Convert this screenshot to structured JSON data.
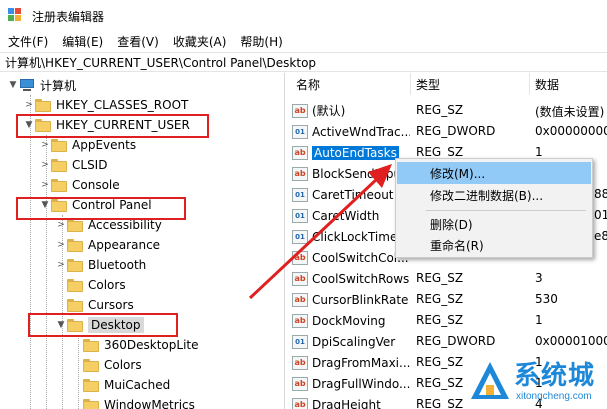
{
  "window": {
    "title": "注册表编辑器"
  },
  "menu": {
    "items": [
      "文件(F)",
      "编辑(E)",
      "查看(V)",
      "收藏夹(A)",
      "帮助(H)"
    ]
  },
  "address": {
    "path": "计算机\\HKEY_CURRENT_USER\\Control Panel\\Desktop"
  },
  "tree": {
    "root": "计算机",
    "items": [
      "HKEY_CLASSES_ROOT",
      "HKEY_CURRENT_USER",
      "AppEvents",
      "CLSID",
      "Console",
      "Control Panel",
      "Accessibility",
      "Appearance",
      "Bluetooth",
      "Colors",
      "Cursors",
      "Desktop",
      "360DesktopLite",
      "Colors",
      "MuiCached",
      "WindowMetrics"
    ]
  },
  "list": {
    "headers": {
      "name": "名称",
      "type": "类型",
      "data": "数据"
    },
    "rows": [
      {
        "icon": "string-value-icon",
        "name": "(默认)",
        "type": "REG_SZ",
        "data": "(数值未设置)"
      },
      {
        "icon": "binary-value-icon",
        "name": "ActiveWndTrac...",
        "type": "REG_DWORD",
        "data": "0x00000000"
      },
      {
        "icon": "string-value-icon",
        "name": "AutoEndTasks",
        "type": "REG_SZ",
        "data": "1"
      },
      {
        "icon": "string-value-icon",
        "name": "BlockSendInpu",
        "type": "",
        "data": ""
      },
      {
        "icon": "binary-value-icon",
        "name": "CaretTimeout",
        "type": "",
        "data": "88"
      },
      {
        "icon": "binary-value-icon",
        "name": "CaretWidth",
        "type": "",
        "data": "01"
      },
      {
        "icon": "binary-value-icon",
        "name": "ClickLockTime",
        "type": "",
        "data": "e8"
      },
      {
        "icon": "string-value-icon",
        "name": "CoolSwitchCol...",
        "type": "",
        "data": ""
      },
      {
        "icon": "string-value-icon",
        "name": "CoolSwitchRows",
        "type": "REG_SZ",
        "data": "3"
      },
      {
        "icon": "string-value-icon",
        "name": "CursorBlinkRate",
        "type": "REG_SZ",
        "data": "530"
      },
      {
        "icon": "string-value-icon",
        "name": "DockMoving",
        "type": "REG_SZ",
        "data": "1"
      },
      {
        "icon": "binary-value-icon",
        "name": "DpiScalingVer",
        "type": "REG_DWORD",
        "data": "0x00001000"
      },
      {
        "icon": "string-value-icon",
        "name": "DragFromMaxi...",
        "type": "REG_SZ",
        "data": "1"
      },
      {
        "icon": "string-value-icon",
        "name": "DragFullWindo...",
        "type": "REG_SZ",
        "data": "1"
      },
      {
        "icon": "string-value-icon",
        "name": "DragHeight",
        "type": "REG_SZ",
        "data": "4"
      }
    ]
  },
  "context_menu": {
    "items": [
      "修改(M)...",
      "修改二进制数据(B)...",
      "删除(D)",
      "重命名(R)"
    ]
  },
  "watermark": {
    "brand": "系统城",
    "url": "xitongcheng.com"
  },
  "colors": {
    "selection": "#0078d7",
    "highlight": "#91c9f7",
    "annotation_red": "#e02020",
    "folder": "#f5cf63"
  }
}
